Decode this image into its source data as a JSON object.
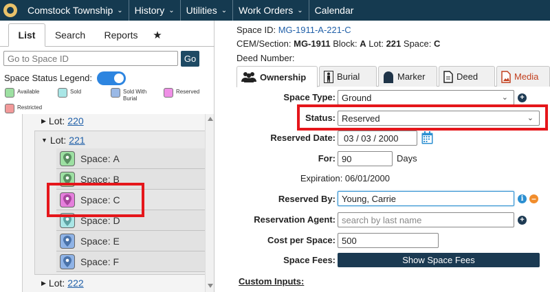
{
  "nav": {
    "items": [
      {
        "label": "Comstock Township",
        "chevron": true
      },
      {
        "label": "History",
        "chevron": true
      },
      {
        "label": "Utilities",
        "chevron": true
      },
      {
        "label": "Work Orders",
        "chevron": true
      },
      {
        "label": "Calendar",
        "chevron": false
      }
    ]
  },
  "left": {
    "tabs": {
      "list": "List",
      "search": "Search",
      "reports": "Reports",
      "star": "★"
    },
    "goto_placeholder": "Go to Space ID",
    "go_label": "Go",
    "legend_title": "Space Status Legend:",
    "legend": [
      {
        "label": "Available",
        "color": "#9de0a2"
      },
      {
        "label": "Sold",
        "color": "#a9e6e6"
      },
      {
        "label": "Sold With Burial",
        "color": "#9ab9e6"
      },
      {
        "label": "Reserved",
        "color": "#ef8fe6"
      },
      {
        "label": "Restricted",
        "color": "#f29a9a"
      }
    ],
    "lot_prefix": "Lot:",
    "lots": {
      "top": "220",
      "open": "221",
      "bottom": "222"
    },
    "space_prefix": "Space:",
    "spaces": [
      {
        "letter": "A",
        "color": "#9de0a2"
      },
      {
        "letter": "B",
        "color": "#9de0a2"
      },
      {
        "letter": "C",
        "color": "#e57fdc"
      },
      {
        "letter": "D",
        "color": "#a9e6e6"
      },
      {
        "letter": "E",
        "color": "#8fb3e6"
      },
      {
        "letter": "F",
        "color": "#8fb3e6"
      }
    ]
  },
  "right": {
    "space_id_label": "Space ID:",
    "space_id": "MG-1911-A-221-C",
    "cem_label": "CEM/Section:",
    "cem_value": "MG-1911",
    "block_label": "Block:",
    "block_value": "A",
    "lot_label": "Lot:",
    "lot_value": "221",
    "space_label": "Space:",
    "space_value": "C",
    "deed_label": "Deed Number:",
    "tabs": [
      "Ownership",
      "Burial",
      "Marker",
      "Deed",
      "Media"
    ],
    "media_color": "#c2401f",
    "fields": {
      "space_type_label": "Space Type:",
      "space_type_value": "Ground",
      "status_label": "Status:",
      "status_value": "Reserved",
      "reserved_date_label": "Reserved Date:",
      "reserved_date_value": "03 / 03 / 2000",
      "for_label": "For:",
      "for_value": "90",
      "for_unit": "Days",
      "expiration_text": "Expiration: 06/01/2000",
      "reserved_by_label": "Reserved By:",
      "reserved_by_value": "Young, Carrie",
      "agent_label": "Reservation Agent:",
      "agent_placeholder": "search by last name",
      "cost_label": "Cost per Space:",
      "cost_value": "500",
      "fees_label": "Space Fees:",
      "fees_button": "Show Space Fees",
      "custom_inputs": "Custom Inputs:"
    }
  },
  "highlight_color": "#e5161b"
}
